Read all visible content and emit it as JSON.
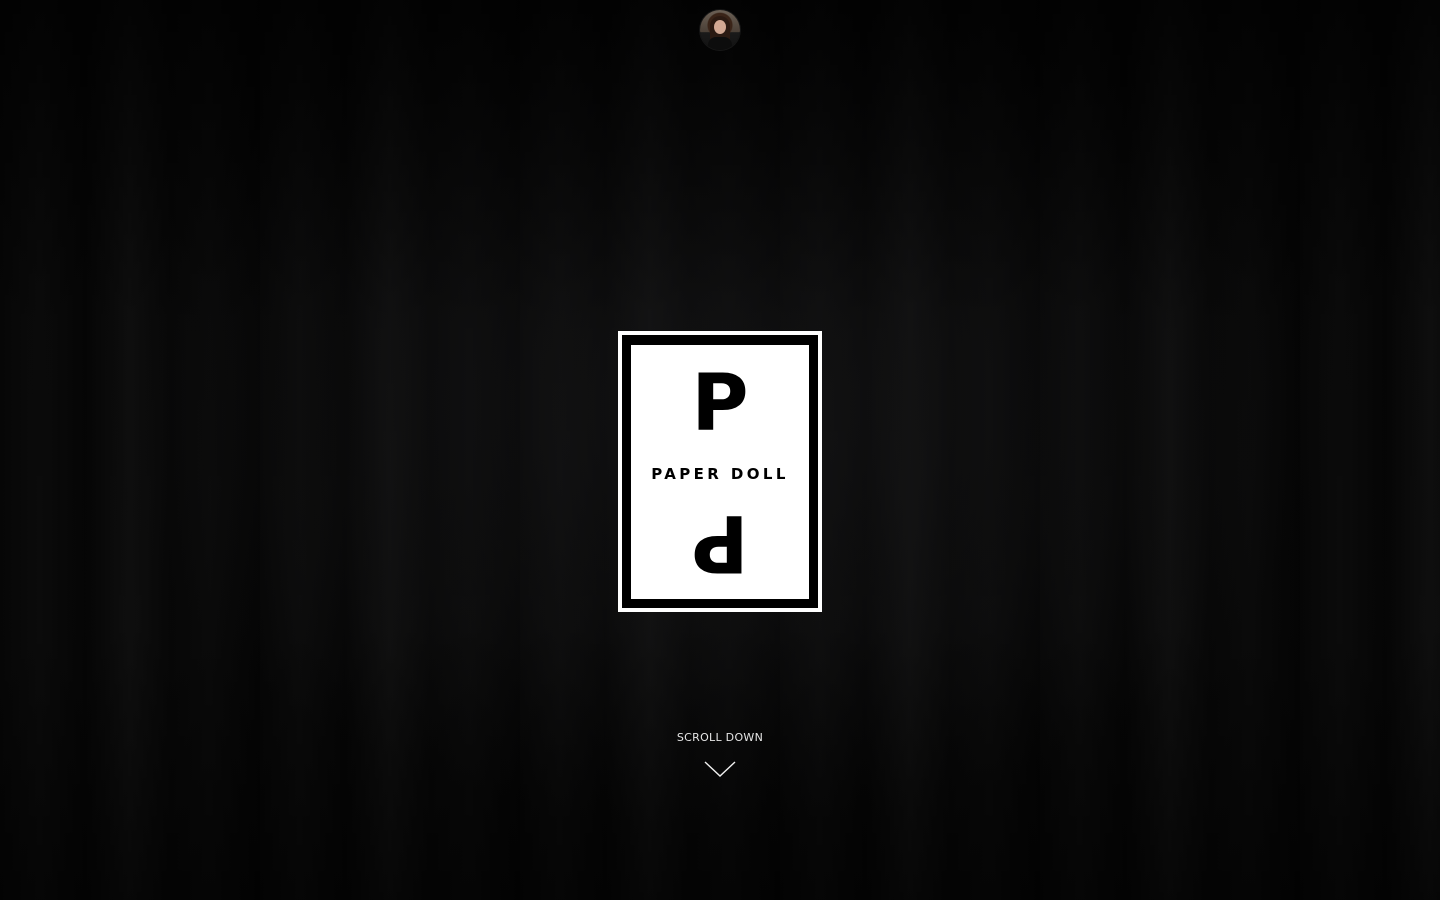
{
  "header": {
    "avatar_icon": "avatar-portrait"
  },
  "logo": {
    "top_letter": "P",
    "brand_name": "PAPER DOLL",
    "bottom_letter": "P"
  },
  "scroll": {
    "label": "SCROLL DOWN",
    "icon": "chevron-down-icon"
  },
  "colors": {
    "background": "#050505",
    "logo_fg": "#000000",
    "logo_bg": "#ffffff",
    "scroll_text": "#e6e6e6"
  }
}
